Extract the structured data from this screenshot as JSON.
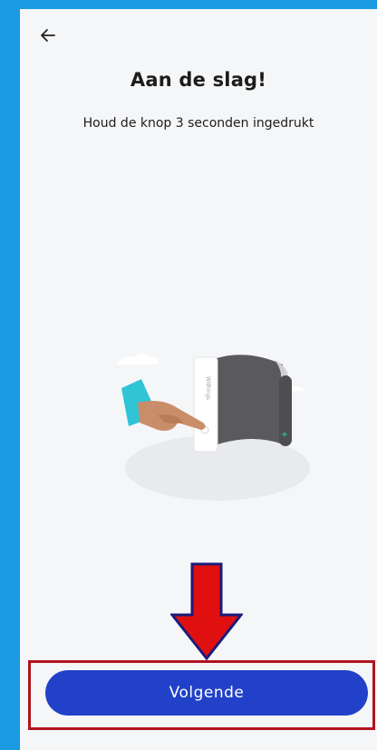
{
  "header": {
    "back_icon": "arrow-left-icon"
  },
  "content": {
    "title": "Aan de slag!",
    "instruction": "Houd de knop 3 seconden ingedrukt",
    "illustration_icon": "blood-pressure-monitor-illustration",
    "device_brand_text": "Withings"
  },
  "annotation": {
    "arrow_icon": "red-down-arrow-icon",
    "arrow_color": "#e01010",
    "box_color": "#b0141e"
  },
  "footer": {
    "next_label": "Volgende",
    "button_color": "#2141c8"
  },
  "colors": {
    "frame": "#1a9ae0",
    "background": "#f5f6f8"
  }
}
